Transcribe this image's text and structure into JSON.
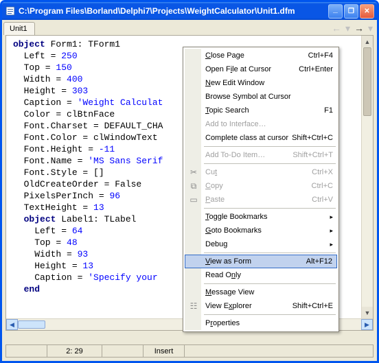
{
  "titlebar": {
    "path": "C:\\Program Files\\Borland\\Delphi7\\Projects\\WeightCalculator\\Unit1.dfm"
  },
  "tabs": {
    "active": "Unit1"
  },
  "nav_arrows": {
    "back": "←",
    "back_dd": "▾",
    "fwd": "→",
    "fwd_dd": "▾"
  },
  "status": {
    "pos": "2: 29",
    "mode": "Insert",
    "modified": ""
  },
  "code": {
    "l1a": "object",
    "l1b": " Form1: TForm1",
    "l2a": "  Left = ",
    "l2b": "250",
    "l3a": "  Top = ",
    "l3b": "150",
    "l4a": "  Width = ",
    "l4b": "400",
    "l5a": "  Height = ",
    "l5b": "303",
    "l6a": "  Caption = ",
    "l6b": "'Weight Calculat",
    "l7": "  Color = clBtnFace",
    "l8": "  Font.Charset = DEFAULT_CHA",
    "l9": "  Font.Color = clWindowText",
    "l10a": "  Font.Height = ",
    "l10b": "-11",
    "l11a": "  Font.Name = ",
    "l11b": "'MS Sans Serif",
    "l12": "  Font.Style = []",
    "l13": "  OldCreateOrder = False",
    "l14a": "  PixelsPerInch = ",
    "l14b": "96",
    "l15a": "  TextHeight = ",
    "l15b": "13",
    "l16a": "  ",
    "l16b": "object",
    "l16c": " Label1: TLabel",
    "l17a": "    Left = ",
    "l17b": "64",
    "l18a": "    Top = ",
    "l18b": "48",
    "l19a": "    Width = ",
    "l19b": "93",
    "l20a": "    Height = ",
    "l20b": "13",
    "l21a": "    Caption = ",
    "l21b": "'Specify your ",
    "l22a": "  ",
    "l22b": "end"
  },
  "ctx": {
    "close_page": "Close Page",
    "close_page_sc": "Ctrl+F4",
    "open_file": "Open File at Cursor",
    "open_file_sc": "Ctrl+Enter",
    "new_edit": "New Edit Window",
    "browse_symbol": "Browse Symbol at Cursor",
    "topic_search": "Topic Search",
    "topic_search_sc": "F1",
    "add_iface": "Add to Interface…",
    "complete_class": "Complete class at cursor",
    "complete_class_sc": "Shift+Ctrl+C",
    "add_todo": "Add To-Do Item…",
    "add_todo_sc": "Shift+Ctrl+T",
    "cut": "Cut",
    "cut_sc": "Ctrl+X",
    "copy": "Copy",
    "copy_sc": "Ctrl+C",
    "paste": "Paste",
    "paste_sc": "Ctrl+V",
    "toggle_bm": "Toggle Bookmarks",
    "goto_bm": "Goto Bookmarks",
    "debug": "Debug",
    "view_form": "View as Form",
    "view_form_sc": "Alt+F12",
    "read_only": "Read Only",
    "message_view": "Message View",
    "view_explorer": "View Explorer",
    "view_explorer_sc": "Shift+Ctrl+E",
    "properties": "Properties",
    "submenu_arrow": "▸",
    "icon_cut": "✂",
    "icon_copy": "⧉",
    "icon_paste": "📋",
    "icon_explorer": "☷"
  }
}
